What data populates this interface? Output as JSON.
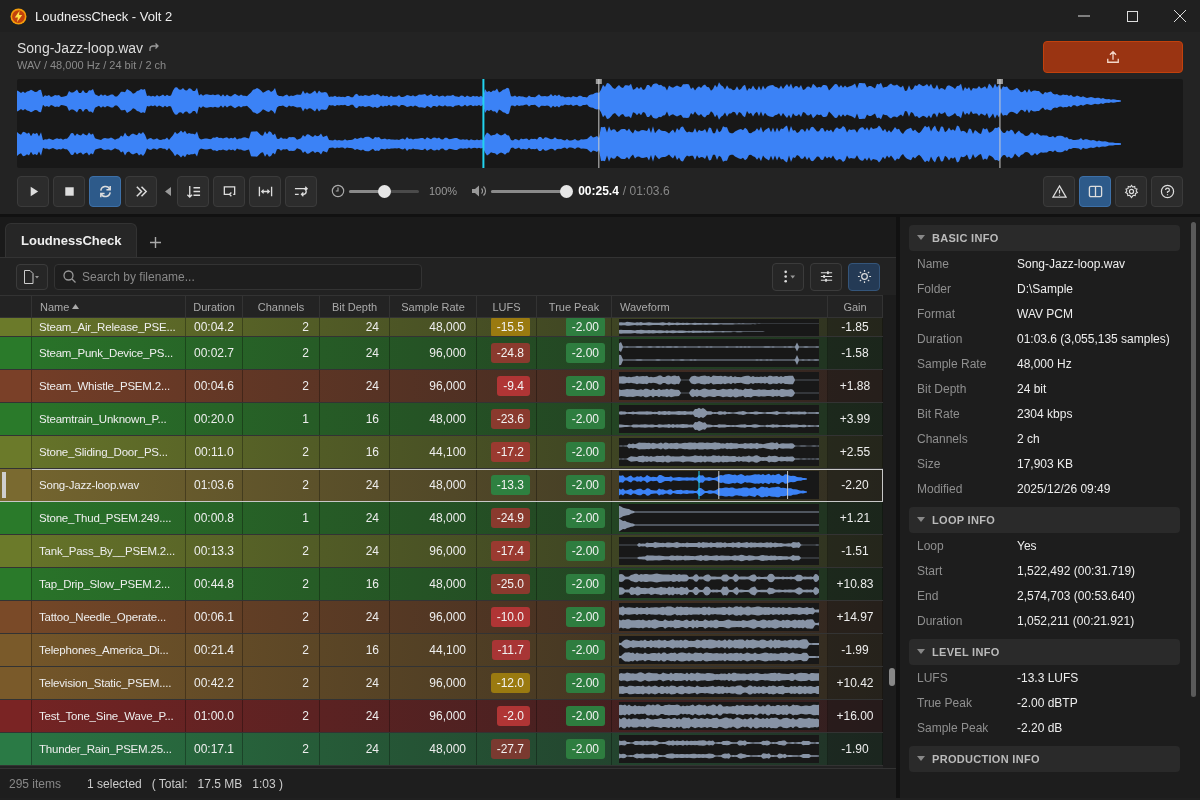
{
  "window": {
    "title": "LoudnessCheck - Volt 2"
  },
  "file": {
    "name": "Song-Jazz-loop.wav",
    "meta": "WAV / 48,000 Hz / 24 bit / 2 ch"
  },
  "transport": [
    {
      "kind": "play",
      "selected": false
    },
    {
      "kind": "stop",
      "selected": false
    },
    {
      "kind": "loop",
      "selected": true
    },
    {
      "kind": "forward",
      "selected": false
    }
  ],
  "edit_buttons": [
    {
      "kind": "lines",
      "selected": false
    },
    {
      "kind": "repeat",
      "selected": false
    },
    {
      "kind": "fit",
      "selected": false
    },
    {
      "kind": "swap",
      "selected": false
    }
  ],
  "speed": {
    "level": 0.5,
    "reading": "100%"
  },
  "volume": {
    "level": 1.0
  },
  "time": {
    "current": "00:25.4",
    "total": "/ 01:03.6"
  },
  "view_buttons": [
    {
      "kind": "warning",
      "selected": false
    },
    {
      "kind": "panel",
      "selected": true
    },
    {
      "kind": "settings",
      "selected": false
    },
    {
      "kind": "help",
      "selected": false
    }
  ],
  "tabs": [
    {
      "label": "LoudnessCheck",
      "selected": true
    }
  ],
  "search": {
    "placeholder": "Search by filename..."
  },
  "tool_buttons": [
    {
      "kind": "more",
      "selected": false
    },
    {
      "kind": "filter",
      "selected": false
    },
    {
      "kind": "theme",
      "selected": true
    }
  ],
  "table": {
    "columns": [
      {
        "label": "Name",
        "sorted": true
      },
      {
        "label": "Duration",
        "sorted": false
      },
      {
        "label": "Channels",
        "sorted": false
      },
      {
        "label": "Bit Depth",
        "sorted": false
      },
      {
        "label": "Sample Rate",
        "sorted": false
      },
      {
        "label": "LUFS",
        "sorted": false
      },
      {
        "label": "True Peak",
        "sorted": false
      },
      {
        "label": "Waveform",
        "sorted": false
      },
      {
        "label": "Gain",
        "sorted": false
      }
    ],
    "rows": [
      {
        "name": "Steam_Air_Release_PSE...",
        "duration": "00:04.2",
        "channels": "2",
        "bit_depth": "24",
        "sample_rate": "48,000",
        "lufs": {
          "text": "-15.5",
          "color": "#9a7a10"
        },
        "true_peak": "-2.00",
        "gain": "-1.85",
        "color": "#6b7a2a",
        "selected": false
      },
      {
        "name": "Steam_Punk_Device_PS...",
        "duration": "00:02.7",
        "channels": "2",
        "bit_depth": "24",
        "sample_rate": "96,000",
        "lufs": {
          "text": "-24.8",
          "color": "#8a3a2e"
        },
        "true_peak": "-2.00",
        "gain": "-1.58",
        "color": "#2a7a2a",
        "selected": false
      },
      {
        "name": "Steam_Whistle_PSEM.2...",
        "duration": "00:04.6",
        "channels": "2",
        "bit_depth": "24",
        "sample_rate": "96,000",
        "lufs": {
          "text": "-9.4",
          "color": "#b03535"
        },
        "true_peak": "-2.00",
        "gain": "+1.88",
        "color": "#7a4028",
        "selected": false
      },
      {
        "name": "Steamtrain_Unknown_P...",
        "duration": "00:20.0",
        "channels": "1",
        "bit_depth": "16",
        "sample_rate": "48,000",
        "lufs": {
          "text": "-23.6",
          "color": "#8a3a2e"
        },
        "true_peak": "-2.00",
        "gain": "+3.99",
        "color": "#2a7a2a",
        "selected": false
      },
      {
        "name": "Stone_Sliding_Door_PS...",
        "duration": "00:11.0",
        "channels": "2",
        "bit_depth": "16",
        "sample_rate": "44,100",
        "lufs": {
          "text": "-17.2",
          "color": "#9a3a30"
        },
        "true_peak": "-2.00",
        "gain": "+2.55",
        "color": "#6b7a2a",
        "selected": false
      },
      {
        "name": "Song-Jazz-loop.wav",
        "duration": "01:03.6",
        "channels": "2",
        "bit_depth": "24",
        "sample_rate": "48,000",
        "lufs": {
          "text": "-13.3",
          "color": "#2e8040"
        },
        "true_peak": "-2.00",
        "gain": "-2.20",
        "color": "#7a6a30",
        "selected": true
      },
      {
        "name": "Stone_Thud_PSEM.249....",
        "duration": "00:00.8",
        "channels": "1",
        "bit_depth": "24",
        "sample_rate": "48,000",
        "lufs": {
          "text": "-24.9",
          "color": "#8a3a2e"
        },
        "true_peak": "-2.00",
        "gain": "+1.21",
        "color": "#2a7a2a",
        "selected": false
      },
      {
        "name": "Tank_Pass_By__PSEM.2...",
        "duration": "00:13.3",
        "channels": "2",
        "bit_depth": "24",
        "sample_rate": "96,000",
        "lufs": {
          "text": "-17.4",
          "color": "#9a3a30"
        },
        "true_peak": "-2.00",
        "gain": "-1.51",
        "color": "#6b7a2a",
        "selected": false
      },
      {
        "name": "Tap_Drip_Slow_PSEM.2...",
        "duration": "00:44.8",
        "channels": "2",
        "bit_depth": "16",
        "sample_rate": "48,000",
        "lufs": {
          "text": "-25.0",
          "color": "#8a3a2e"
        },
        "true_peak": "-2.00",
        "gain": "+10.83",
        "color": "#2a7a2a",
        "selected": false
      },
      {
        "name": "Tattoo_Needle_Operate...",
        "duration": "00:06.1",
        "channels": "2",
        "bit_depth": "24",
        "sample_rate": "96,000",
        "lufs": {
          "text": "-10.0",
          "color": "#b03535"
        },
        "true_peak": "-2.00",
        "gain": "+14.97",
        "color": "#7a4a28",
        "selected": false
      },
      {
        "name": "Telephones_America_Di...",
        "duration": "00:21.4",
        "channels": "2",
        "bit_depth": "16",
        "sample_rate": "44,100",
        "lufs": {
          "text": "-11.7",
          "color": "#a83535"
        },
        "true_peak": "-2.00",
        "gain": "-1.99",
        "color": "#7a5a2a",
        "selected": false
      },
      {
        "name": "Television_Static_PSEM....",
        "duration": "00:42.2",
        "channels": "2",
        "bit_depth": "24",
        "sample_rate": "96,000",
        "lufs": {
          "text": "-12.0",
          "color": "#9a7a10"
        },
        "true_peak": "-2.00",
        "gain": "+10.42",
        "color": "#7a5a2a",
        "selected": false
      },
      {
        "name": "Test_Tone_Sine_Wave_P...",
        "duration": "01:00.0",
        "channels": "2",
        "bit_depth": "24",
        "sample_rate": "96,000",
        "lufs": {
          "text": "-2.0",
          "color": "#b03535"
        },
        "true_peak": "-2.00",
        "gain": "+16.00",
        "color": "#7a2424",
        "selected": false
      },
      {
        "name": "Thunder_Rain_PSEM.25...",
        "duration": "00:17.1",
        "channels": "2",
        "bit_depth": "24",
        "sample_rate": "48,000",
        "lufs": {
          "text": "-27.7",
          "color": "#7a3a30"
        },
        "true_peak": "-2.00",
        "gain": "-1.90",
        "color": "#2a7a45",
        "selected": false
      }
    ]
  },
  "status_bar": {
    "count": "295 items",
    "selected": "1 selected",
    "total_label": "( Total:",
    "size": "17.5 MB",
    "length": "1:03 )"
  },
  "info_sections": [
    {
      "title": "BASIC INFO",
      "expanded": true,
      "rows": [
        {
          "label": "Name",
          "value": "Song-Jazz-loop.wav"
        },
        {
          "label": "Folder",
          "value": "D:\\Sample"
        },
        {
          "label": "Format",
          "value": "WAV PCM"
        },
        {
          "label": "Duration",
          "value": "01:03.6 (3,055,135 samples)"
        },
        {
          "label": "Sample Rate",
          "value": "48,000 Hz"
        },
        {
          "label": "Bit Depth",
          "value": "24 bit"
        },
        {
          "label": "Bit Rate",
          "value": "2304 kbps"
        },
        {
          "label": "Channels",
          "value": "2 ch"
        },
        {
          "label": "Size",
          "value": "17,903 KB"
        },
        {
          "label": "Modified",
          "value": "2025/12/26 09:49"
        }
      ]
    },
    {
      "title": "LOOP INFO",
      "expanded": true,
      "rows": [
        {
          "label": "Loop",
          "value": "Yes"
        },
        {
          "label": "Start",
          "value": "1,522,492 (00:31.719)"
        },
        {
          "label": "End",
          "value": "2,574,703 (00:53.640)"
        },
        {
          "label": "Duration",
          "value": "1,052,211 (00:21.921)"
        }
      ]
    },
    {
      "title": "LEVEL INFO",
      "expanded": true,
      "rows": [
        {
          "label": "LUFS",
          "value": "-13.3 LUFS"
        },
        {
          "label": "True Peak",
          "value": "-2.00 dBTP"
        },
        {
          "label": "Sample Peak",
          "value": "-2.20 dB"
        }
      ]
    },
    {
      "title": "PRODUCTION INFO",
      "expanded": true
    }
  ]
}
